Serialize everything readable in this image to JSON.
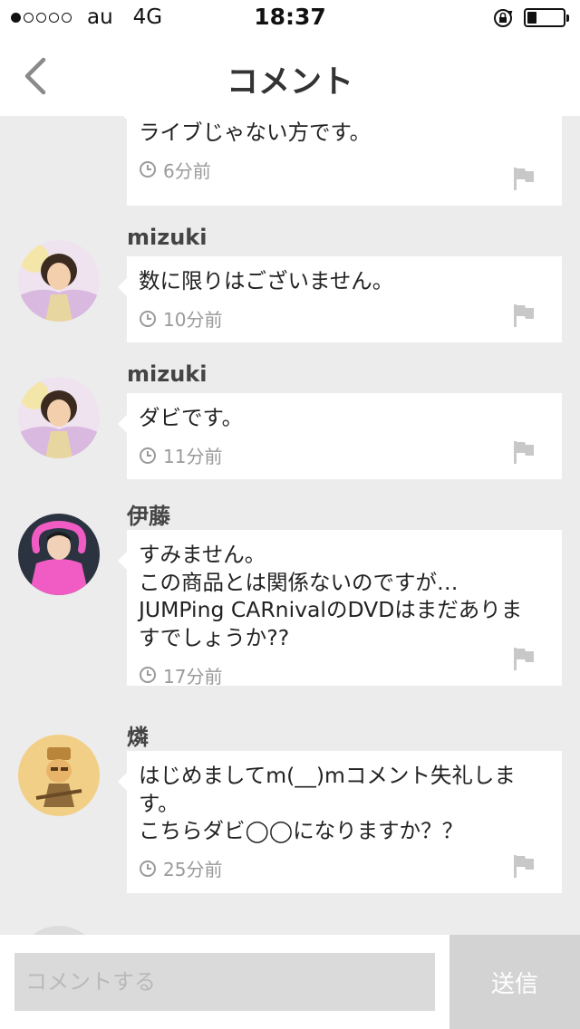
{
  "status_bar": {
    "carrier": "au",
    "network": "4G",
    "time": "18:37",
    "signal_filled": 1,
    "signal_total": 5,
    "battery_level": 0.2
  },
  "nav": {
    "back_icon": "chevron-left-icon",
    "title": "コメント"
  },
  "comments": [
    {
      "name": "",
      "text": "DVDだけを購入することは出来ますか？\nライブじゃない方です。",
      "time": "6分前",
      "avatar": "none"
    },
    {
      "name": "mizuki",
      "text": "数に限りはございません。",
      "time": "10分前",
      "avatar": "photo-avatar-mizuki"
    },
    {
      "name": "mizuki",
      "text": "ダビです。",
      "time": "11分前",
      "avatar": "photo-avatar-mizuki"
    },
    {
      "name": "伊藤",
      "text": "すみません。\nこの商品とは関係ないのですが…\nJUMPing CARnivalのDVDはまだありま\nすでしょうか??",
      "time": "17分前",
      "avatar": "photo-avatar-ito"
    },
    {
      "name": "燐",
      "text": "はじめましてm(__)mコメント失礼しま\nす。\nこちらダビ◯◯になりますか？？",
      "time": "25分前",
      "avatar": "illustration-avatar-rin"
    }
  ],
  "composer": {
    "placeholder": "コメントする",
    "value": "",
    "send_label": "送信"
  },
  "colors": {
    "background": "#ececec",
    "card": "#ffffff",
    "meta_text": "#9a9a9a",
    "send_button": "#d3d3d3",
    "input": "#dadada"
  }
}
